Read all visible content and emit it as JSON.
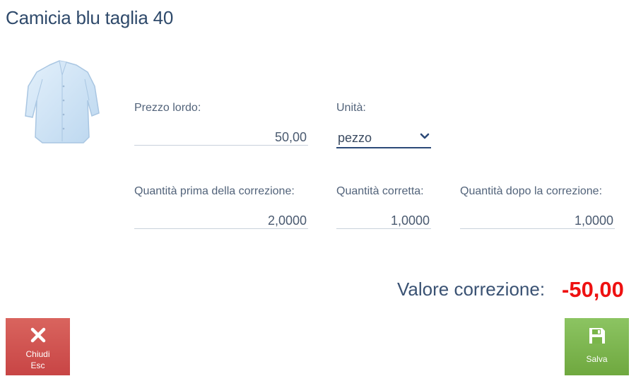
{
  "page": {
    "title": "Camicia blu taglia 40"
  },
  "product": {
    "image_icon": "shirt-image"
  },
  "fields": {
    "gross_price": {
      "label": "Prezzo lordo:",
      "value": "50,00"
    },
    "unit": {
      "label": "Unità:",
      "value": "pezzo",
      "icon": "chevron-down-icon"
    },
    "qty_before": {
      "label": "Quantità prima della correzione:",
      "value": "2,0000"
    },
    "qty_corrected": {
      "label": "Quantità corretta:",
      "value": "1,0000"
    },
    "qty_after": {
      "label": "Quantità dopo la correzione:",
      "value": "1,0000"
    }
  },
  "correction": {
    "label": "Valore correzione:",
    "value": "-50,00",
    "color": "#ee1111"
  },
  "buttons": {
    "close": {
      "label": "Chiudi",
      "shortcut": "Esc",
      "icon": "close-icon",
      "color": "#c84545"
    },
    "save": {
      "label": "Salva",
      "icon": "save-icon",
      "color": "#7ab64a"
    }
  }
}
